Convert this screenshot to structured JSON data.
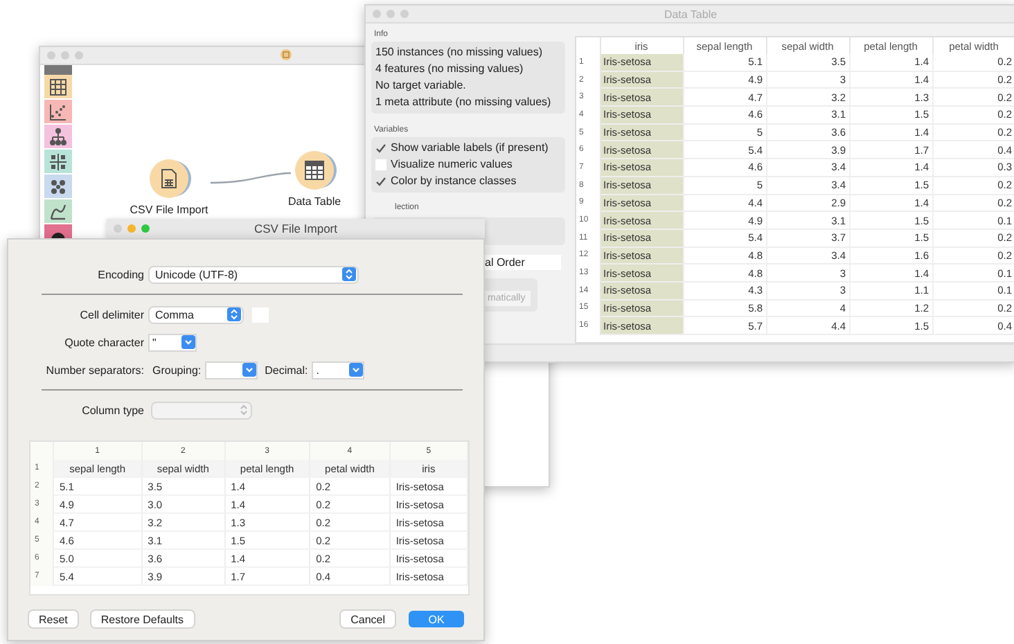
{
  "canvas_window": {
    "toolbox": [
      {
        "kind": "table",
        "color": "#f6d9a8"
      },
      {
        "kind": "scatter",
        "color": "#f7b7b5"
      },
      {
        "kind": "tree",
        "color": "#f5c2de"
      },
      {
        "kind": "grid",
        "color": "#b8e3d8"
      },
      {
        "kind": "cluster",
        "color": "#c9d9ee"
      },
      {
        "kind": "curve",
        "color": "#c0e2cb"
      },
      {
        "kind": "round",
        "color": "#e2708f"
      }
    ],
    "nodes": [
      {
        "label": "CSV File Import",
        "kind": "file"
      },
      {
        "label": "Data Table",
        "kind": "table"
      }
    ]
  },
  "data_table_window": {
    "title": "Data Table",
    "info": {
      "title": "Info",
      "lines": [
        "150 instances (no missing values)",
        "4 features (no missing values)",
        "No target variable.",
        "1 meta attribute (no missing values)"
      ]
    },
    "variables": {
      "title": "Variables",
      "options": [
        {
          "label": "Show variable labels (if present)",
          "checked": true
        },
        {
          "label": "Visualize numeric values",
          "checked": false
        },
        {
          "label": "Color by instance classes",
          "checked": true
        }
      ]
    },
    "selection_title": "lection",
    "order_field": "al Order",
    "commit_button": "matically",
    "table": {
      "columns": [
        "iris",
        "sepal length",
        "sepal width",
        "petal length",
        "petal width"
      ],
      "rows": [
        {
          "number": "1",
          "cells": [
            "Iris-setosa",
            "5.1",
            "3.5",
            "1.4",
            "0.2"
          ]
        },
        {
          "number": "2",
          "cells": [
            "Iris-setosa",
            "4.9",
            "3",
            "1.4",
            "0.2"
          ]
        },
        {
          "number": "3",
          "cells": [
            "Iris-setosa",
            "4.7",
            "3.2",
            "1.3",
            "0.2"
          ]
        },
        {
          "number": "4",
          "cells": [
            "Iris-setosa",
            "4.6",
            "3.1",
            "1.5",
            "0.2"
          ]
        },
        {
          "number": "5",
          "cells": [
            "Iris-setosa",
            "5",
            "3.6",
            "1.4",
            "0.2"
          ]
        },
        {
          "number": "6",
          "cells": [
            "Iris-setosa",
            "5.4",
            "3.9",
            "1.7",
            "0.4"
          ]
        },
        {
          "number": "7",
          "cells": [
            "Iris-setosa",
            "4.6",
            "3.4",
            "1.4",
            "0.3"
          ]
        },
        {
          "number": "8",
          "cells": [
            "Iris-setosa",
            "5",
            "3.4",
            "1.5",
            "0.2"
          ]
        },
        {
          "number": "9",
          "cells": [
            "Iris-setosa",
            "4.4",
            "2.9",
            "1.4",
            "0.2"
          ]
        },
        {
          "number": "10",
          "cells": [
            "Iris-setosa",
            "4.9",
            "3.1",
            "1.5",
            "0.1"
          ]
        },
        {
          "number": "11",
          "cells": [
            "Iris-setosa",
            "5.4",
            "3.7",
            "1.5",
            "0.2"
          ]
        },
        {
          "number": "12",
          "cells": [
            "Iris-setosa",
            "4.8",
            "3.4",
            "1.6",
            "0.2"
          ]
        },
        {
          "number": "13",
          "cells": [
            "Iris-setosa",
            "4.8",
            "3",
            "1.4",
            "0.1"
          ]
        },
        {
          "number": "14",
          "cells": [
            "Iris-setosa",
            "4.3",
            "3",
            "1.1",
            "0.1"
          ]
        },
        {
          "number": "15",
          "cells": [
            "Iris-setosa",
            "5.8",
            "4",
            "1.2",
            "0.2"
          ]
        },
        {
          "number": "16",
          "cells": [
            "Iris-setosa",
            "5.7",
            "4.4",
            "1.5",
            "0.4"
          ]
        }
      ]
    }
  },
  "csv_dialog": {
    "title": "CSV File Import",
    "encoding": {
      "label": "Encoding",
      "value": "Unicode (UTF-8)"
    },
    "cell_delimiter": {
      "label": "Cell delimiter",
      "value": "Comma"
    },
    "quote_character": {
      "label": "Quote character",
      "value": "\""
    },
    "number_separators": {
      "label": "Number separators:",
      "grouping_label": "Grouping:",
      "decimal_label": "Decimal:",
      "decimal_value": "."
    },
    "column_type": {
      "label": "Column type",
      "disabled": true
    },
    "preview": {
      "column_numbers": [
        "1",
        "2",
        "3",
        "4",
        "5"
      ],
      "rows": [
        {
          "number": "1",
          "cells": [
            "sepal length",
            "sepal width",
            "petal length",
            "petal width",
            "iris"
          ]
        },
        {
          "number": "2",
          "cells": [
            "5.1",
            "3.5",
            "1.4",
            "0.2",
            "Iris-setosa"
          ]
        },
        {
          "number": "3",
          "cells": [
            "4.9",
            "3.0",
            "1.4",
            "0.2",
            "Iris-setosa"
          ]
        },
        {
          "number": "4",
          "cells": [
            "4.7",
            "3.2",
            "1.3",
            "0.2",
            "Iris-setosa"
          ]
        },
        {
          "number": "5",
          "cells": [
            "4.6",
            "3.1",
            "1.5",
            "0.2",
            "Iris-setosa"
          ]
        },
        {
          "number": "6",
          "cells": [
            "5.0",
            "3.6",
            "1.4",
            "0.2",
            "Iris-setosa"
          ]
        },
        {
          "number": "7",
          "cells": [
            "5.4",
            "3.9",
            "1.7",
            "0.4",
            "Iris-setosa"
          ]
        }
      ]
    },
    "left_buttons": [
      {
        "label": "Reset",
        "default": false
      },
      {
        "label": "Restore Defaults",
        "default": false
      }
    ],
    "right_buttons": [
      {
        "label": "Cancel",
        "default": false
      },
      {
        "label": "OK",
        "default": true
      }
    ]
  }
}
